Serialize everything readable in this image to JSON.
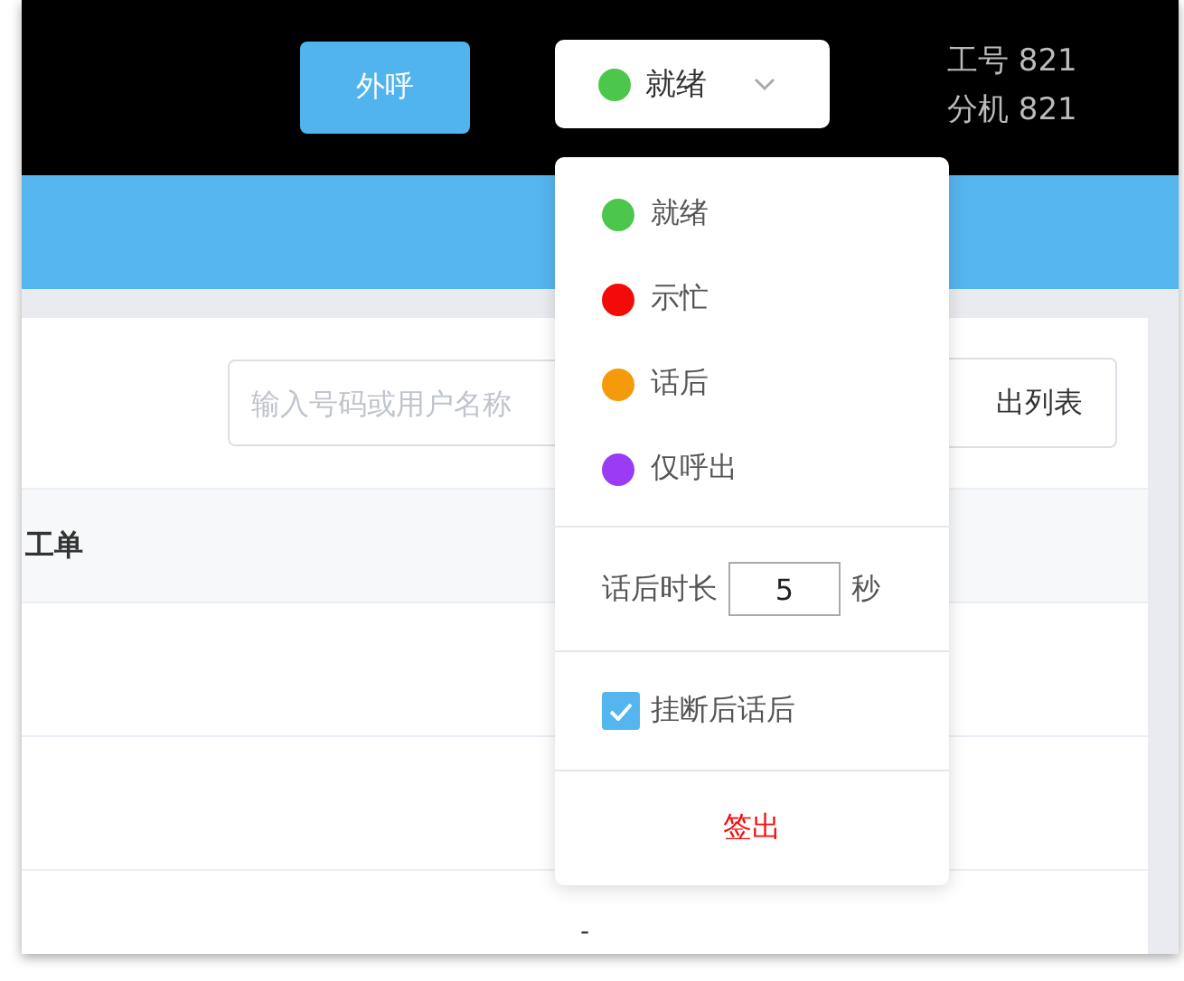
{
  "header": {
    "call_button": "外呼",
    "status": {
      "label": "就绪",
      "color": "#4cc74c",
      "expanded": true
    },
    "agent_lines": [
      "工号 821",
      "分机 821"
    ]
  },
  "toolbar": {
    "search": {
      "placeholder": "输入号码或用户名称"
    },
    "export_button": "出列表"
  },
  "table": {
    "columns": [
      "工单"
    ],
    "rows": [
      {
        "cell": ""
      },
      {
        "cell": ""
      },
      {
        "cell": "-"
      }
    ]
  },
  "status_menu": {
    "items": [
      {
        "label": "就绪",
        "color": "#4cc74c"
      },
      {
        "label": "示忙",
        "color": "#f50a0a"
      },
      {
        "label": "话后",
        "color": "#f59a0a"
      },
      {
        "label": "仅呼出",
        "color": "#9a3cf5"
      }
    ],
    "duration": {
      "label": "话后时长",
      "value": "5",
      "unit": "秒"
    },
    "hangup_option": {
      "label": "挂断后话后",
      "checked": true
    },
    "logout": "签出"
  }
}
